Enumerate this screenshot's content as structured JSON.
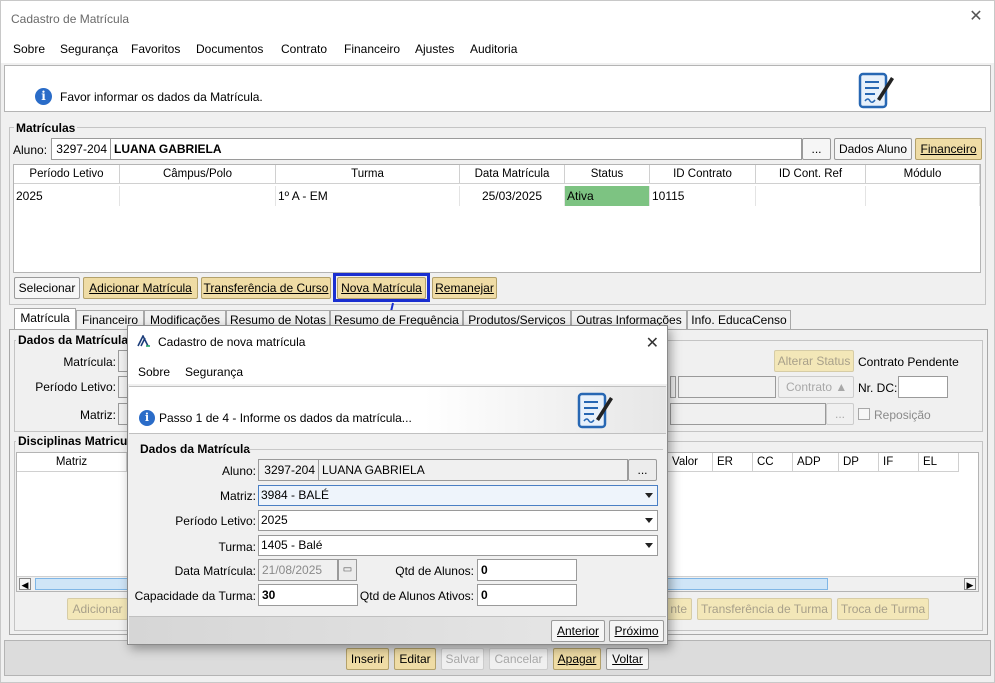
{
  "window": {
    "title": "Cadastro de Matrícula"
  },
  "menu": [
    "Sobre",
    "Segurança",
    "Favoritos",
    "Documentos",
    "Contrato",
    "Financeiro",
    "Ajustes",
    "Auditoria"
  ],
  "header": {
    "message": "Favor informar os dados da Matrícula."
  },
  "matriculas": {
    "group_label": "Matrículas",
    "aluno_label": "Aluno:",
    "aluno_code": "3297-204",
    "aluno_name": "LUANA GABRIELA",
    "ellipsis": "...",
    "dados_aluno": "Dados Aluno",
    "financeiro": "Financeiro",
    "columns": [
      "Período Letivo",
      "Câmpus/Polo",
      "Turma",
      "Data Matrícula",
      "Status",
      "ID Contrato",
      "ID Cont. Ref",
      "Módulo"
    ],
    "row": {
      "periodo": "2025",
      "campus": "",
      "turma": "1º A - EM",
      "data": "25/03/2025",
      "status": "Ativa",
      "id_contrato": "10115",
      "id_ref": "",
      "modulo": ""
    },
    "status_color": "#7dc382",
    "buttons": [
      "Selecionar",
      "Adicionar Matrícula",
      "Transferência de Curso",
      "Nova Matrícula",
      "Remanejar"
    ]
  },
  "tabs": [
    "Matrícula",
    "Financeiro",
    "Modificações",
    "Resumo de Notas",
    "Resumo de Frequência",
    "Produtos/Serviços",
    "Outras Informações",
    "Info. EducaCenso"
  ],
  "dados": {
    "group_label": "Dados da Matrícula",
    "matricula_label": "Matrícula:",
    "periodo_label": "Período Letivo:",
    "matriz_label": "Matriz:",
    "alterar_status": "Alterar Status",
    "contrato_pendente": "Contrato Pendente",
    "contrato": "Contrato",
    "nr_dc": "Nr. DC:",
    "ellipsis": "...",
    "reposicao": "Reposição"
  },
  "disciplinas": {
    "group_label": "Disciplinas Matriculadas",
    "col_matriz": "Matriz",
    "cols_right": [
      "Valor",
      "ER",
      "CC",
      "ADP",
      "DP",
      "IF",
      "EL"
    ],
    "adicionar": "Adicionar",
    "btn_partial": "nte",
    "transferencia_turma": "Transferência de Turma",
    "troca_turma": "Troca de Turma"
  },
  "bottom_buttons": [
    "Inserir",
    "Editar",
    "Salvar",
    "Cancelar",
    "Apagar",
    "Voltar"
  ],
  "dialog": {
    "title": "Cadastro de nova matrícula",
    "menu": [
      "Sobre",
      "Segurança"
    ],
    "step": "Passo 1 de 4 - Informe os dados da matrícula...",
    "group_label": "Dados da Matrícula",
    "aluno_label": "Aluno:",
    "aluno_code": "3297-204",
    "aluno_name": "LUANA GABRIELA",
    "ellipsis": "...",
    "matriz_label": "Matriz:",
    "matriz_value": "3984 - BALÉ",
    "periodo_label": "Período Letivo:",
    "periodo_value": "2025",
    "turma_label": "Turma:",
    "turma_value": "1405 - Balé",
    "data_label": "Data Matrícula:",
    "data_value": "21/08/2025",
    "qtd_label": "Qtd de Alunos:",
    "qtd_value": "0",
    "capacidade_label": "Capacidade da Turma:",
    "capacidade_value": "30",
    "qtd_ativos_label": "Qtd de Alunos Ativos:",
    "qtd_ativos_value": "0",
    "anterior": "Anterior",
    "proximo": "Próximo"
  },
  "highlight_color": "#1a2fd0"
}
